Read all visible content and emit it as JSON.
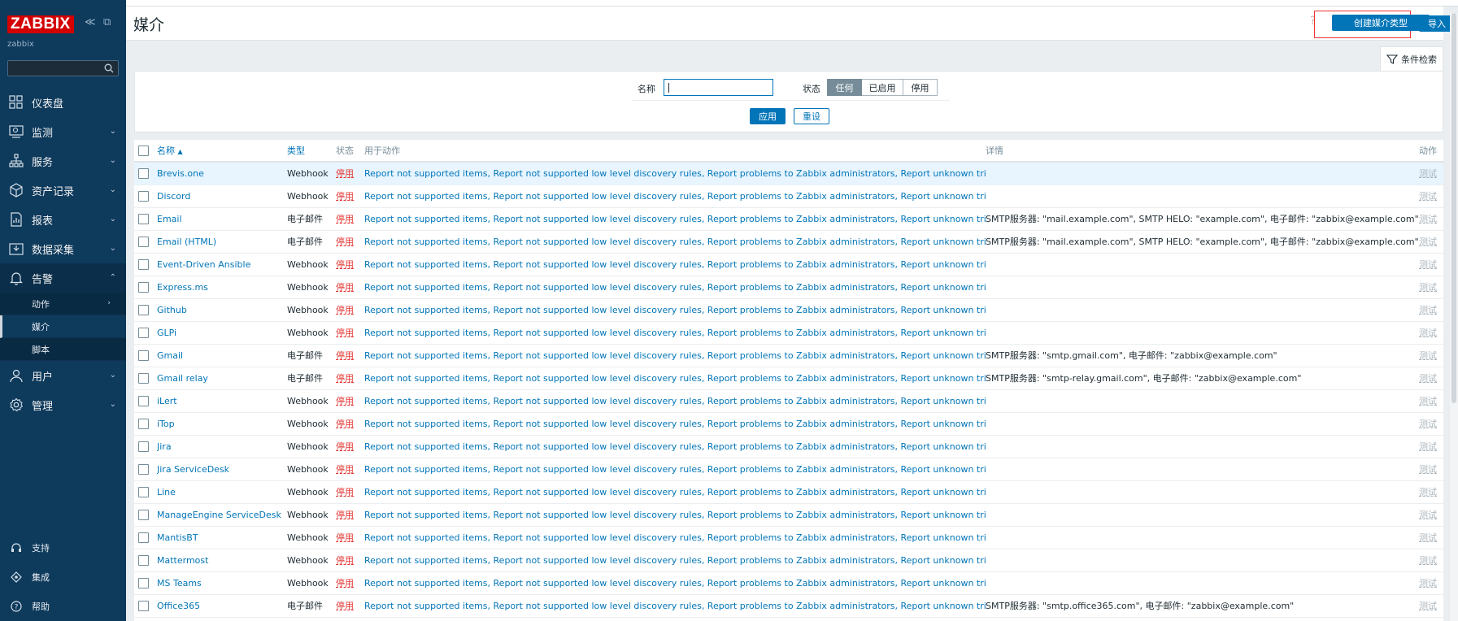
{
  "sidebar": {
    "logo": "ZABBIX",
    "collapse_glyph": "≪",
    "kiosk_glyph": "⧉",
    "server_name": "zabbix",
    "search_placeholder": "",
    "nav": [
      {
        "label": "仪表盘",
        "icon": "dashboard-icon",
        "chevron": ""
      },
      {
        "label": "监测",
        "icon": "monitoring-icon",
        "chevron": "⌄"
      },
      {
        "label": "服务",
        "icon": "services-icon",
        "chevron": "⌄"
      },
      {
        "label": "资产记录",
        "icon": "inventory-icon",
        "chevron": "⌄"
      },
      {
        "label": "报表",
        "icon": "reports-icon",
        "chevron": "⌄"
      },
      {
        "label": "数据采集",
        "icon": "data-collection-icon",
        "chevron": "⌄"
      },
      {
        "label": "告警",
        "icon": "alerts-bell-icon",
        "chevron": "⌃"
      }
    ],
    "alerts_sub": [
      {
        "label": "动作",
        "chevron": "›"
      },
      {
        "label": "媒介",
        "chevron": ""
      },
      {
        "label": "脚本",
        "chevron": ""
      }
    ],
    "nav_after": [
      {
        "label": "用户",
        "icon": "users-icon",
        "chevron": "⌄"
      },
      {
        "label": "管理",
        "icon": "administration-gear-icon",
        "chevron": "⌄"
      }
    ],
    "bottom": [
      {
        "label": "支持",
        "icon": "support-icon"
      },
      {
        "label": "集成",
        "icon": "integrations-icon"
      },
      {
        "label": "帮助",
        "icon": "help-circle-icon"
      }
    ]
  },
  "header": {
    "title": "媒介",
    "help_glyph": "?",
    "create_label": "创建媒介类型",
    "import_label": "导入"
  },
  "filter": {
    "tab_label": "条件检索",
    "name_label": "名称",
    "name_value": "",
    "status_label": "状态",
    "status_options": [
      "任何",
      "已启用",
      "停用"
    ],
    "status_selected": "任何",
    "apply_label": "应用",
    "reset_label": "重设"
  },
  "table": {
    "columns": {
      "name": "名称",
      "sort_arrow": "▲",
      "type": "类型",
      "status": "状态",
      "used_in_actions": "用于动作",
      "details": "详情",
      "action": "动作"
    },
    "rows": [
      {
        "name": "Brevis.one",
        "type": "Webhook",
        "status": "停用",
        "actions": "Report not supported items, Report not supported low level discovery rules, Report problems to Zabbix administrators, Report unknown triggers",
        "details": "",
        "test": "测试"
      },
      {
        "name": "Discord",
        "type": "Webhook",
        "status": "停用",
        "actions": "Report not supported items, Report not supported low level discovery rules, Report problems to Zabbix administrators, Report unknown triggers",
        "details": "",
        "test": "测试"
      },
      {
        "name": "Email",
        "type": "电子邮件",
        "status": "停用",
        "actions": "Report not supported items, Report not supported low level discovery rules, Report problems to Zabbix administrators, Report unknown triggers",
        "details": "SMTP服务器: \"mail.example.com\", SMTP HELO: \"example.com\", 电子邮件: \"zabbix@example.com\"",
        "test": "测试"
      },
      {
        "name": "Email (HTML)",
        "type": "电子邮件",
        "status": "停用",
        "actions": "Report not supported items, Report not supported low level discovery rules, Report problems to Zabbix administrators, Report unknown triggers",
        "details": "SMTP服务器: \"mail.example.com\", SMTP HELO: \"example.com\", 电子邮件: \"zabbix@example.com\"",
        "test": "测试"
      },
      {
        "name": "Event-Driven Ansible",
        "type": "Webhook",
        "status": "停用",
        "actions": "Report not supported items, Report not supported low level discovery rules, Report problems to Zabbix administrators, Report unknown triggers",
        "details": "",
        "test": "测试"
      },
      {
        "name": "Express.ms",
        "type": "Webhook",
        "status": "停用",
        "actions": "Report not supported items, Report not supported low level discovery rules, Report problems to Zabbix administrators, Report unknown triggers",
        "details": "",
        "test": "测试"
      },
      {
        "name": "Github",
        "type": "Webhook",
        "status": "停用",
        "actions": "Report not supported items, Report not supported low level discovery rules, Report problems to Zabbix administrators, Report unknown triggers",
        "details": "",
        "test": "测试"
      },
      {
        "name": "GLPi",
        "type": "Webhook",
        "status": "停用",
        "actions": "Report not supported items, Report not supported low level discovery rules, Report problems to Zabbix administrators, Report unknown triggers",
        "details": "",
        "test": "测试"
      },
      {
        "name": "Gmail",
        "type": "电子邮件",
        "status": "停用",
        "actions": "Report not supported items, Report not supported low level discovery rules, Report problems to Zabbix administrators, Report unknown triggers",
        "details": "SMTP服务器: \"smtp.gmail.com\", 电子邮件: \"zabbix@example.com\"",
        "test": "测试"
      },
      {
        "name": "Gmail relay",
        "type": "电子邮件",
        "status": "停用",
        "actions": "Report not supported items, Report not supported low level discovery rules, Report problems to Zabbix administrators, Report unknown triggers",
        "details": "SMTP服务器: \"smtp-relay.gmail.com\", 电子邮件: \"zabbix@example.com\"",
        "test": "测试"
      },
      {
        "name": "iLert",
        "type": "Webhook",
        "status": "停用",
        "actions": "Report not supported items, Report not supported low level discovery rules, Report problems to Zabbix administrators, Report unknown triggers",
        "details": "",
        "test": "测试"
      },
      {
        "name": "iTop",
        "type": "Webhook",
        "status": "停用",
        "actions": "Report not supported items, Report not supported low level discovery rules, Report problems to Zabbix administrators, Report unknown triggers",
        "details": "",
        "test": "测试"
      },
      {
        "name": "Jira",
        "type": "Webhook",
        "status": "停用",
        "actions": "Report not supported items, Report not supported low level discovery rules, Report problems to Zabbix administrators, Report unknown triggers",
        "details": "",
        "test": "测试"
      },
      {
        "name": "Jira ServiceDesk",
        "type": "Webhook",
        "status": "停用",
        "actions": "Report not supported items, Report not supported low level discovery rules, Report problems to Zabbix administrators, Report unknown triggers",
        "details": "",
        "test": "测试"
      },
      {
        "name": "Line",
        "type": "Webhook",
        "status": "停用",
        "actions": "Report not supported items, Report not supported low level discovery rules, Report problems to Zabbix administrators, Report unknown triggers",
        "details": "",
        "test": "测试"
      },
      {
        "name": "ManageEngine ServiceDesk",
        "type": "Webhook",
        "status": "停用",
        "actions": "Report not supported items, Report not supported low level discovery rules, Report problems to Zabbix administrators, Report unknown triggers",
        "details": "",
        "test": "测试"
      },
      {
        "name": "MantisBT",
        "type": "Webhook",
        "status": "停用",
        "actions": "Report not supported items, Report not supported low level discovery rules, Report problems to Zabbix administrators, Report unknown triggers",
        "details": "",
        "test": "测试"
      },
      {
        "name": "Mattermost",
        "type": "Webhook",
        "status": "停用",
        "actions": "Report not supported items, Report not supported low level discovery rules, Report problems to Zabbix administrators, Report unknown triggers",
        "details": "",
        "test": "测试"
      },
      {
        "name": "MS Teams",
        "type": "Webhook",
        "status": "停用",
        "actions": "Report not supported items, Report not supported low level discovery rules, Report problems to Zabbix administrators, Report unknown triggers",
        "details": "",
        "test": "测试"
      },
      {
        "name": "Office365",
        "type": "电子邮件",
        "status": "停用",
        "actions": "Report not supported items, Report not supported low level discovery rules, Report problems to Zabbix administrators, Report unknown triggers",
        "details": "SMTP服务器: \"smtp.office365.com\", 电子邮件: \"zabbix@example.com\"",
        "test": "测试"
      }
    ]
  },
  "colors": {
    "sidebar_bg": "#0e3a5c",
    "accent": "#0275b8",
    "status_disabled": "#e33734",
    "logo_red": "#d40000"
  }
}
